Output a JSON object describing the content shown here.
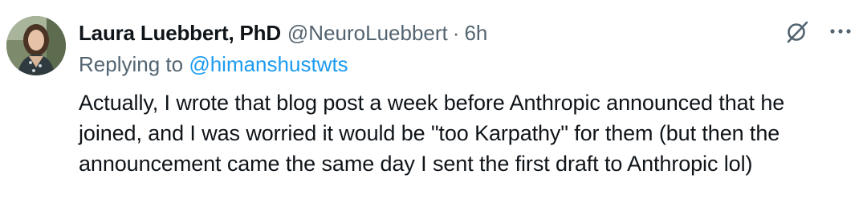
{
  "tweet": {
    "author": {
      "display_name": "Laura Luebbert, PhD",
      "handle": "@NeuroLuebbert",
      "separator": "·",
      "time": "6h"
    },
    "reply": {
      "prefix": "Replying to",
      "to_handle": "@himanshustwts"
    },
    "lines": [
      "Actually, I wrote that blog post a week before Anthropic announced that he",
      "joined, and I was worried it would be \"too Karpathy\" for them (but then the",
      "announcement came the same day I sent the first draft to Anthropic lol)"
    ],
    "icons": {
      "grok": "grok-icon",
      "more": "more-options-icon"
    }
  }
}
